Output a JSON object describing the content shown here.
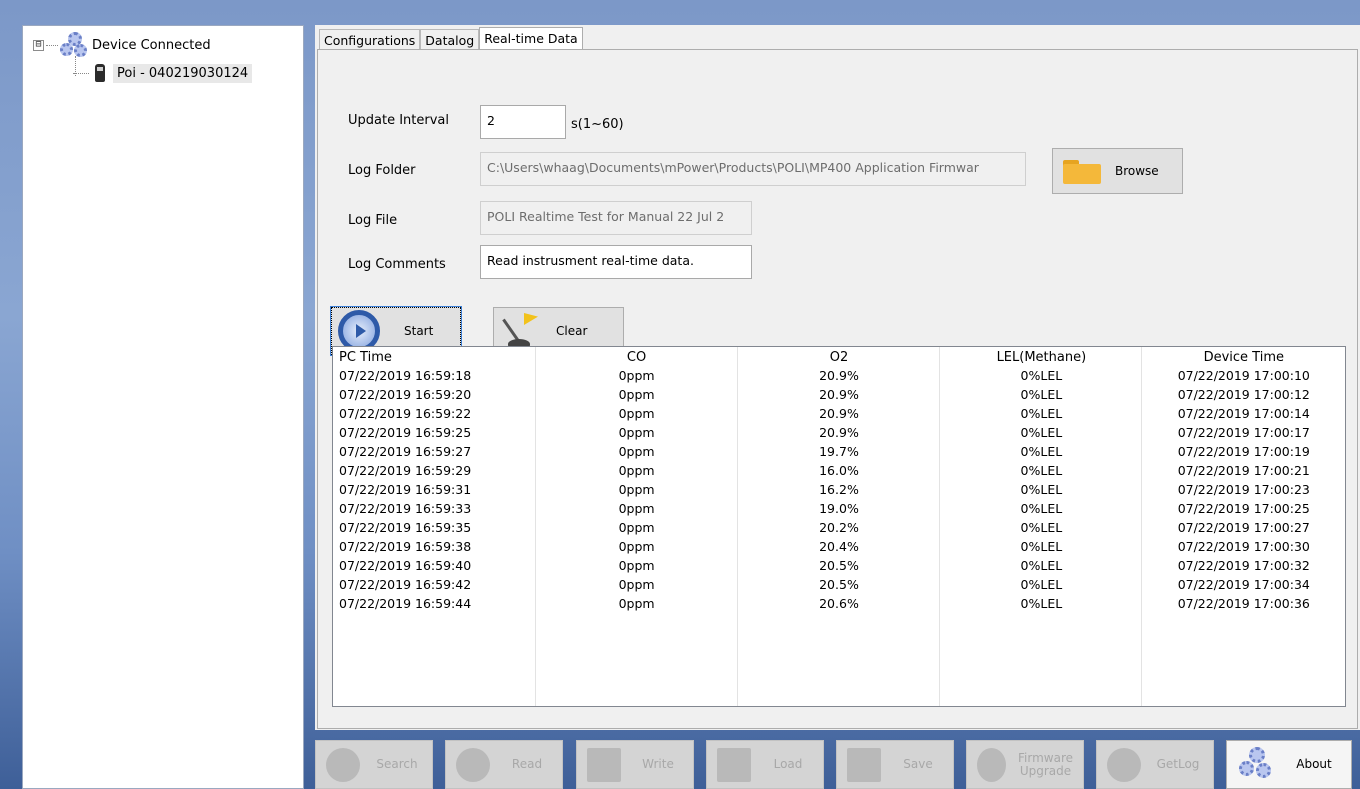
{
  "tree": {
    "root_label": "Device Connected",
    "expander": "⊟",
    "child_label": "Poi - 040219030124"
  },
  "tabs": [
    {
      "label": "Configurations",
      "active": false
    },
    {
      "label": "Datalog",
      "active": false
    },
    {
      "label": "Real-time Data",
      "active": true
    }
  ],
  "form": {
    "update_interval_label": "Update Interval",
    "update_interval_value": "2",
    "update_interval_hint": "s(1~60)",
    "log_folder_label": "Log Folder",
    "log_folder_value": "C:\\Users\\whaag\\Documents\\mPower\\Products\\POLI\\MP400 Application Firmwar",
    "browse_label": "Browse",
    "log_file_label": "Log File",
    "log_file_value": "POLI Realtime Test for Manual 22 Jul 2",
    "log_comments_label": "Log Comments",
    "log_comments_value": "Read instrusment real-time data."
  },
  "actions": {
    "start_label": "Start",
    "clear_label": "Clear"
  },
  "table": {
    "headers": [
      "PC Time",
      "CO",
      "O2",
      "LEL(Methane)",
      "Device Time"
    ],
    "rows": [
      [
        "07/22/2019 16:59:18",
        "0ppm",
        "20.9%",
        "0%LEL",
        "07/22/2019 17:00:10"
      ],
      [
        "07/22/2019 16:59:20",
        "0ppm",
        "20.9%",
        "0%LEL",
        "07/22/2019 17:00:12"
      ],
      [
        "07/22/2019 16:59:22",
        "0ppm",
        "20.9%",
        "0%LEL",
        "07/22/2019 17:00:14"
      ],
      [
        "07/22/2019 16:59:25",
        "0ppm",
        "20.9%",
        "0%LEL",
        "07/22/2019 17:00:17"
      ],
      [
        "07/22/2019 16:59:27",
        "0ppm",
        "19.7%",
        "0%LEL",
        "07/22/2019 17:00:19"
      ],
      [
        "07/22/2019 16:59:29",
        "0ppm",
        "16.0%",
        "0%LEL",
        "07/22/2019 17:00:21"
      ],
      [
        "07/22/2019 16:59:31",
        "0ppm",
        "16.2%",
        "0%LEL",
        "07/22/2019 17:00:23"
      ],
      [
        "07/22/2019 16:59:33",
        "0ppm",
        "19.0%",
        "0%LEL",
        "07/22/2019 17:00:25"
      ],
      [
        "07/22/2019 16:59:35",
        "0ppm",
        "20.2%",
        "0%LEL",
        "07/22/2019 17:00:27"
      ],
      [
        "07/22/2019 16:59:38",
        "0ppm",
        "20.4%",
        "0%LEL",
        "07/22/2019 17:00:30"
      ],
      [
        "07/22/2019 16:59:40",
        "0ppm",
        "20.5%",
        "0%LEL",
        "07/22/2019 17:00:32"
      ],
      [
        "07/22/2019 16:59:42",
        "0ppm",
        "20.5%",
        "0%LEL",
        "07/22/2019 17:00:34"
      ],
      [
        "07/22/2019 16:59:44",
        "0ppm",
        "20.6%",
        "0%LEL",
        "07/22/2019 17:00:36"
      ]
    ]
  },
  "toolbar": {
    "search": "Search",
    "read": "Read",
    "write": "Write",
    "load": "Load",
    "save": "Save",
    "firmware_line1": "Firmware",
    "firmware_line2": "Upgrade",
    "getlog": "GetLog",
    "about": "About"
  },
  "icons": {
    "tree_root": "gears-icon",
    "tree_child": "device-icon",
    "browse": "folder-icon",
    "start": "start-icon",
    "clear": "clear-icon",
    "search": "magnifier-icon",
    "read": "read-icon",
    "write": "write-icon",
    "load": "load-icon",
    "save": "save-icon",
    "firmware": "firmware-icon",
    "getlog": "getlog-icon",
    "about": "gears-icon"
  },
  "colors": {
    "desktop_blue": "#7c98c8",
    "focus_blue": "#3c7fd6",
    "folder_yellow": "#f4b83a"
  }
}
